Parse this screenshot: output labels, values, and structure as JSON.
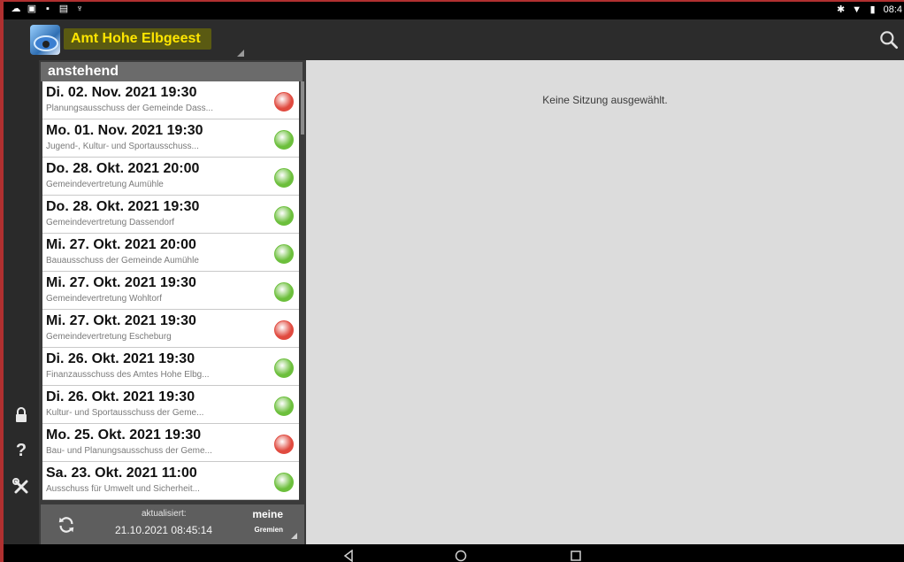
{
  "status_bar": {
    "time": "08:4",
    "left_icons": [
      "cloud-icon",
      "picture-icon",
      "video-icon",
      "mail-icon",
      "usb-icon"
    ],
    "right_icons": [
      "bluetooth-icon",
      "wifi-icon",
      "battery-icon"
    ]
  },
  "app_bar": {
    "title": "Amt Hohe Elbgeest"
  },
  "list": {
    "header": "anstehend",
    "items": [
      {
        "date": "Di. 02. Nov. 2021  19:30",
        "sub": "Planungsausschuss der Gemeinde Dass...",
        "status": "red"
      },
      {
        "date": "Mo. 01. Nov. 2021  19:30",
        "sub": "Jugend-, Kultur- und Sportausschuss...",
        "status": "green"
      },
      {
        "date": "Do. 28. Okt. 2021  20:00",
        "sub": "Gemeindevertretung Aumühle",
        "status": "green"
      },
      {
        "date": "Do. 28. Okt. 2021  19:30",
        "sub": "Gemeindevertretung Dassendorf",
        "status": "green"
      },
      {
        "date": "Mi. 27. Okt. 2021  20:00",
        "sub": "Bauausschuss der Gemeinde Aumühle",
        "status": "green"
      },
      {
        "date": "Mi. 27. Okt. 2021  19:30",
        "sub": "Gemeindevertretung Wohltorf",
        "status": "green"
      },
      {
        "date": "Mi. 27. Okt. 2021  19:30",
        "sub": "Gemeindevertretung Escheburg",
        "status": "red"
      },
      {
        "date": "Di. 26. Okt. 2021  19:30",
        "sub": "Finanzausschuss des Amtes Hohe Elbg...",
        "status": "green"
      },
      {
        "date": "Di. 26. Okt. 2021  19:30",
        "sub": "Kultur- und Sportausschuss der Geme...",
        "status": "green"
      },
      {
        "date": "Mo. 25. Okt. 2021  19:30",
        "sub": "Bau- und Planungsausschuss der Geme...",
        "status": "red"
      },
      {
        "date": "Sa. 23. Okt. 2021  11:00",
        "sub": "Ausschuss für Umwelt und Sicherheit...",
        "status": "green"
      }
    ],
    "footer": {
      "updated_label": "aktualisiert:",
      "updated_time": "21.10.2021 08:45:14",
      "filter_title": "meine",
      "filter_sub": "Gremien"
    }
  },
  "detail": {
    "empty_message": "Keine Sitzung ausgewählt."
  },
  "side_rail": {
    "icons": [
      "lock-icon",
      "help-icon",
      "tools-icon"
    ],
    "help_glyph": "?"
  },
  "colors": {
    "status_red": "#e04a3f",
    "status_green": "#6cbf3c",
    "title_text": "#ffe600"
  }
}
